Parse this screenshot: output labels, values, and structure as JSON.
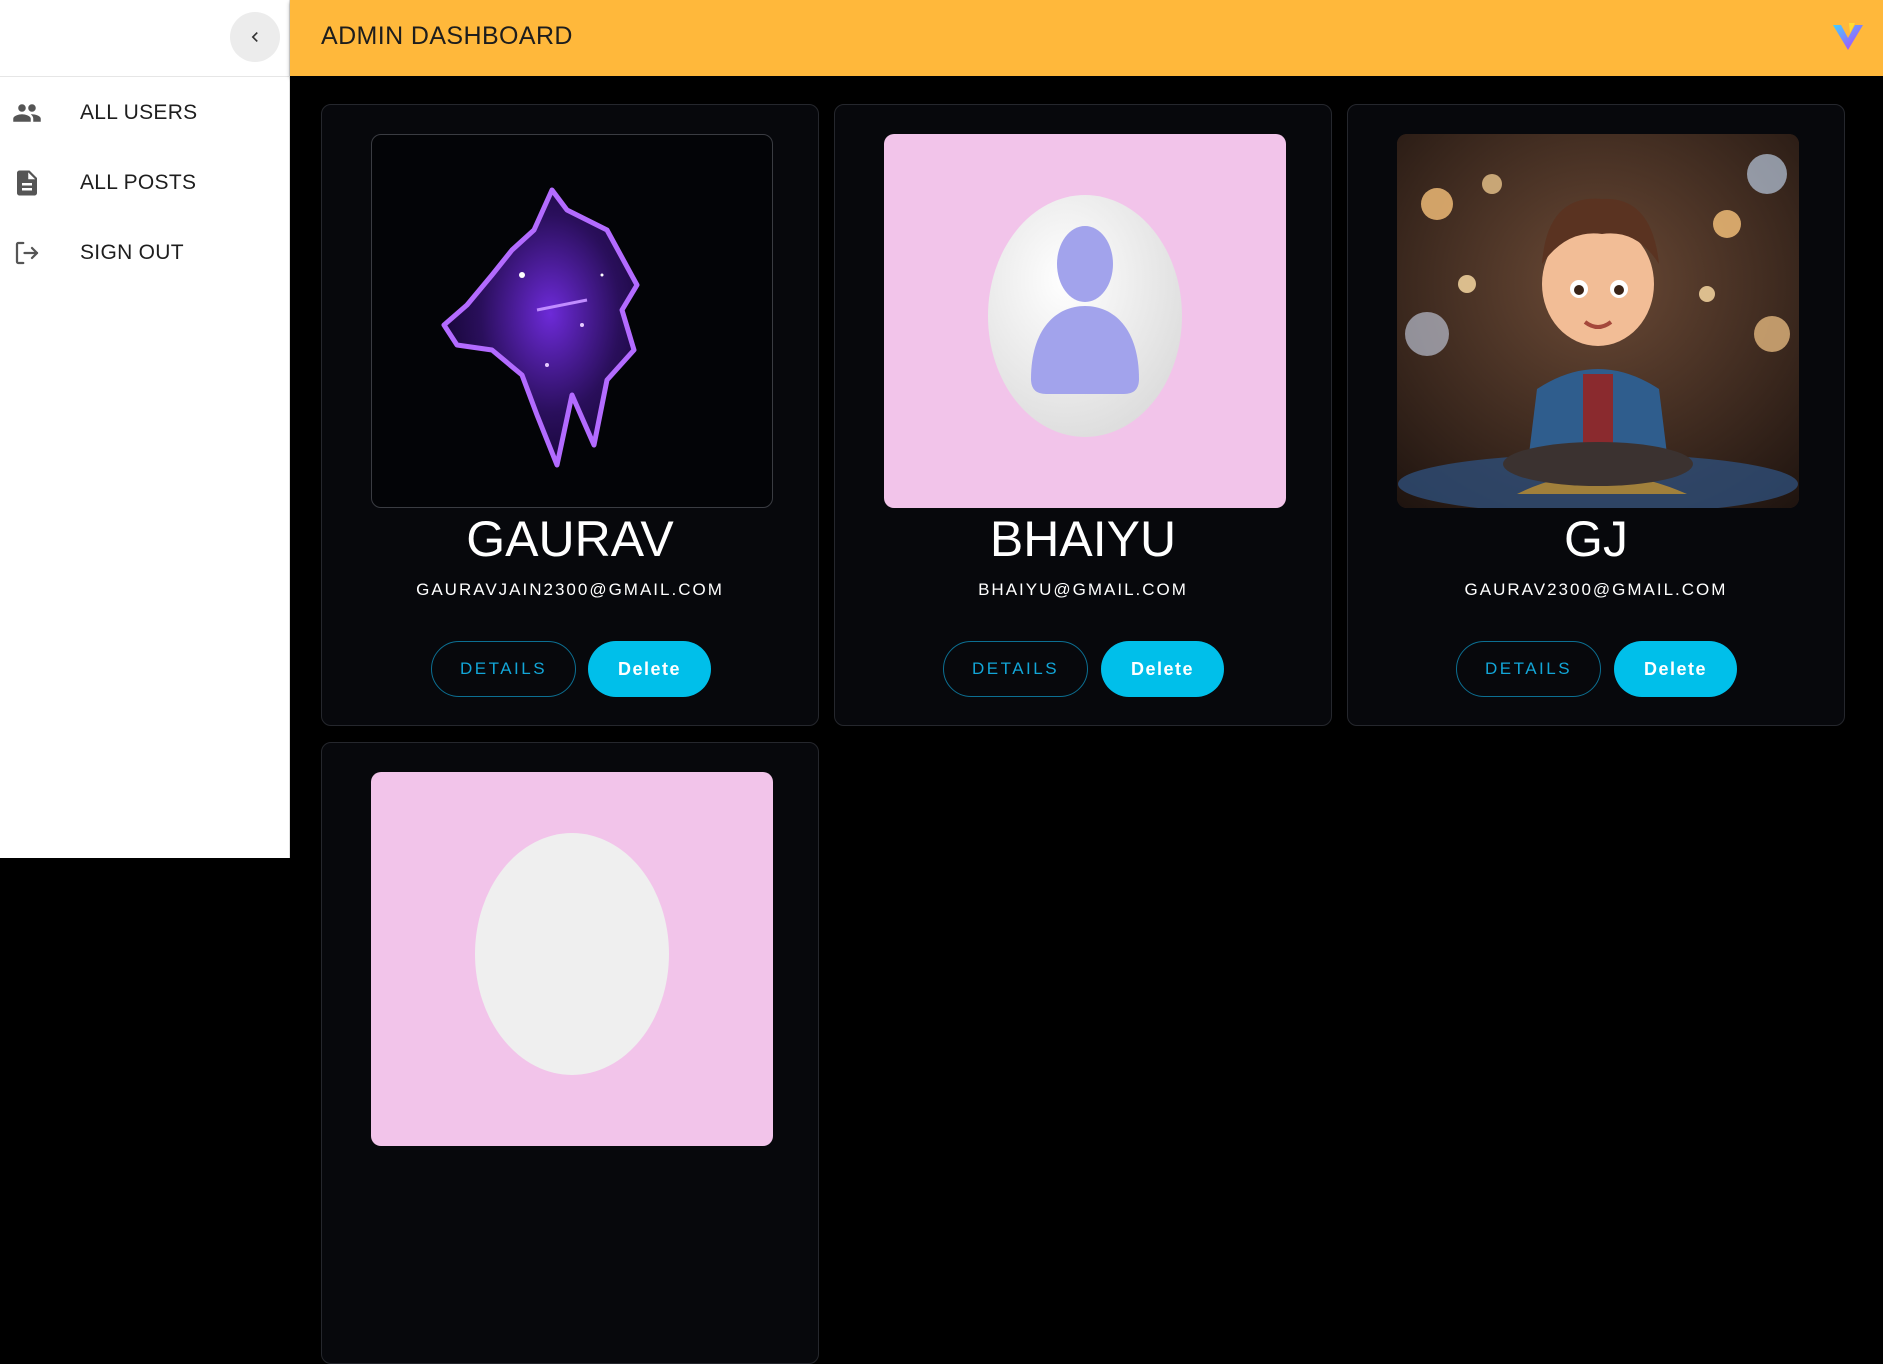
{
  "header": {
    "title": "ADMIN DASHBOARD",
    "logo_icon": "v-logo-icon"
  },
  "sidebar": {
    "collapse_icon": "chevron-left-icon",
    "items": [
      {
        "label": "ALL USERS",
        "icon": "people-icon"
      },
      {
        "label": "ALL POSTS",
        "icon": "article-icon"
      },
      {
        "label": "SIGN OUT",
        "icon": "logout-icon"
      }
    ]
  },
  "users": [
    {
      "name": "GAURAV",
      "email": "GAURAVJAIN2300@GMAIL.COM",
      "avatar": "purple-wolf-image",
      "details_label": "DETAILS",
      "delete_label": "Delete"
    },
    {
      "name": "BHAIYU",
      "email": "BHAIYU@GMAIL.COM",
      "avatar": "default-user-image",
      "details_label": "DETAILS",
      "delete_label": "Delete"
    },
    {
      "name": "GJ",
      "email": "GAURAV2300@GMAIL.COM",
      "avatar": "cartoon-boy-image",
      "details_label": "DETAILS",
      "delete_label": "Delete"
    },
    {
      "name": "",
      "email": "",
      "avatar": "default-user-image",
      "details_label": "",
      "delete_label": ""
    }
  ],
  "colors": {
    "appbar": "#ffb83b",
    "background": "#000000",
    "card": "#07080c",
    "accent": "#00bfea",
    "avatar_pink": "#f2c4ea"
  }
}
